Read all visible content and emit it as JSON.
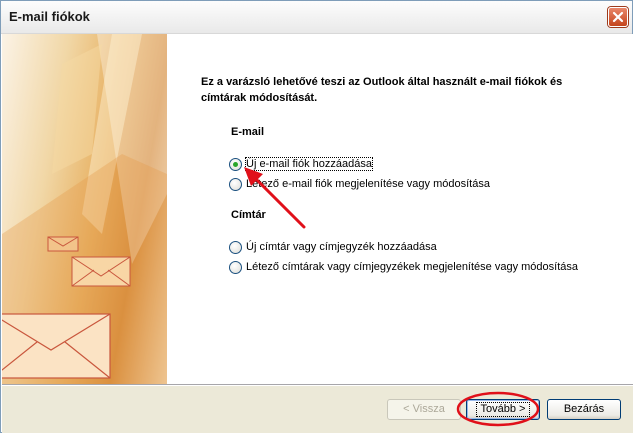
{
  "window": {
    "title": "E-mail fiókok"
  },
  "intro_text": "Ez a varázsló lehetővé teszi az Outlook által használt e-mail fiókok és címtárak módosítását.",
  "email_section": {
    "title": "E-mail",
    "options": [
      {
        "label": "Új e-mail fiók hozzáadása",
        "checked": true
      },
      {
        "label": "Létező e-mail fiók megjelenítése vagy módosítása",
        "checked": false
      }
    ]
  },
  "directory_section": {
    "title": "Címtár",
    "options": [
      {
        "label": "Új címtár vagy címjegyzék hozzáadása",
        "checked": false
      },
      {
        "label": "Létező címtárak vagy címjegyzékek megjelenítése vagy módosítása",
        "checked": false
      }
    ]
  },
  "buttons": {
    "back": "< Vissza",
    "next": "Tovább >",
    "close": "Bezárás"
  },
  "icons": {
    "close": "close-icon",
    "side_art": "envelope-icon"
  },
  "colors": {
    "annotation": "#e0101a",
    "footer": "#ece9d8",
    "side_panel": "#e7b061"
  }
}
